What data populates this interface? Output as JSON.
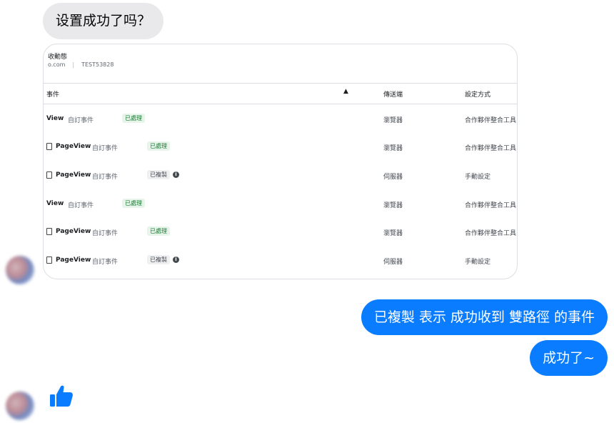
{
  "messages": {
    "incoming_text": "设置成功了吗？",
    "outgoing_1": "已複製 表示 成功收到 雙路徑 的事件",
    "outgoing_2": "成功了~"
  },
  "screenshot": {
    "title": "收動態",
    "domain": "o.com",
    "pixel_id": "TEST53828",
    "headers": {
      "event": "事件",
      "warning": "▲",
      "sender": "傳送端",
      "method": "設定方式"
    },
    "rows": [
      {
        "name": "View",
        "type": "自訂事件",
        "status": "已處理",
        "sender": "瀏覽器",
        "method": "合作夥伴整合工具"
      },
      {
        "name": "PageView",
        "type": "自訂事件",
        "status": "已處理",
        "sender": "瀏覽器",
        "method": "合作夥伴整合工具"
      },
      {
        "name": "PageView",
        "type": "自訂事件",
        "status": "已複製",
        "sender": "伺服器",
        "method": "手動設定"
      },
      {
        "name": "View",
        "type": "自訂事件",
        "status": "已處理",
        "sender": "瀏覽器",
        "method": "合作夥伴整合工具"
      },
      {
        "name": "PageView",
        "type": "自訂事件",
        "status": "已處理",
        "sender": "瀏覽器",
        "method": "合作夥伴整合工具"
      },
      {
        "name": "PageView",
        "type": "自訂事件",
        "status": "已複製",
        "sender": "伺服器",
        "method": "手動設定"
      }
    ],
    "info_glyph": "i"
  },
  "reaction": {
    "icon": "thumbs-up-icon",
    "color": "#0a7cff"
  },
  "colors": {
    "outgoing_bubble": "#0a7cff",
    "incoming_bubble": "#e9e9eb"
  }
}
